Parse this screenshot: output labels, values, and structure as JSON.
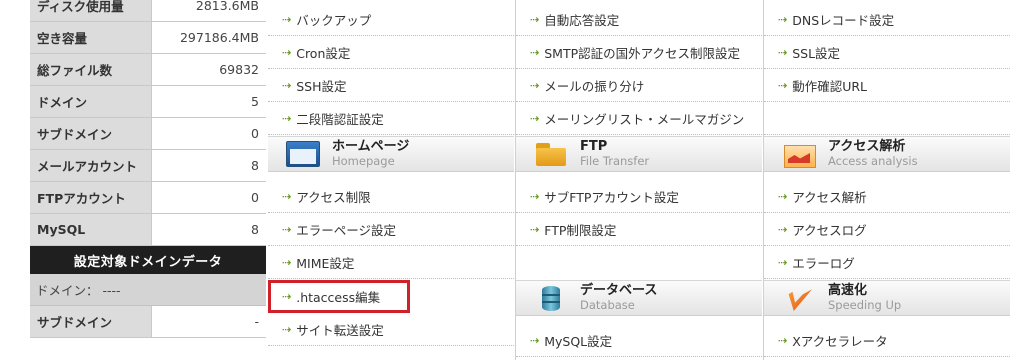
{
  "stats": [
    {
      "label": "ディスク使用量",
      "value": "2813.6MB"
    },
    {
      "label": "空き容量",
      "value": "297186.4MB"
    },
    {
      "label": "総ファイル数",
      "value": "69832"
    },
    {
      "label": "ドメイン",
      "value": "5"
    },
    {
      "label": "サブドメイン",
      "value": "0"
    },
    {
      "label": "メールアカウント",
      "value": "8"
    },
    {
      "label": "FTPアカウント",
      "value": "0"
    },
    {
      "label": "MySQL",
      "value": "8"
    }
  ],
  "domain_panel": {
    "header": "設定対象ドメインデータ",
    "domain_label": "ドメイン： ----",
    "subdomain_label": "サブドメイン",
    "subdomain_value": "-"
  },
  "arrow_glyph": "⇢",
  "col1": {
    "items": [
      "バックアップ",
      "Cron設定",
      "SSH設定",
      "二段階認証設定"
    ],
    "section": {
      "title": "ホームページ",
      "subtitle": "Homepage"
    },
    "items2": [
      "アクセス制限",
      "エラーページ設定",
      "MIME設定",
      ".htaccess編集",
      "サイト転送設定"
    ]
  },
  "col2": {
    "items": [
      "自動応答設定",
      "SMTP認証の国外アクセス制限設定",
      "メールの振り分け",
      "メーリングリスト・メールマガジン"
    ],
    "section": {
      "title": "FTP",
      "subtitle": "File Transfer"
    },
    "items2": [
      "サブFTPアカウント設定",
      "FTP制限設定"
    ],
    "section2": {
      "title": "データベース",
      "subtitle": "Database"
    },
    "items3": [
      "MySQL設定"
    ]
  },
  "col3": {
    "items": [
      "DNSレコード設定",
      "SSL設定",
      "動作確認URL"
    ],
    "section": {
      "title": "アクセス解析",
      "subtitle": "Access analysis"
    },
    "items2": [
      "アクセス解析",
      "アクセスログ",
      "エラーログ"
    ],
    "section2": {
      "title": "高速化",
      "subtitle": "Speeding Up"
    },
    "items3": [
      "Xアクセラレータ"
    ]
  },
  "highlight_color": "#d0202a"
}
